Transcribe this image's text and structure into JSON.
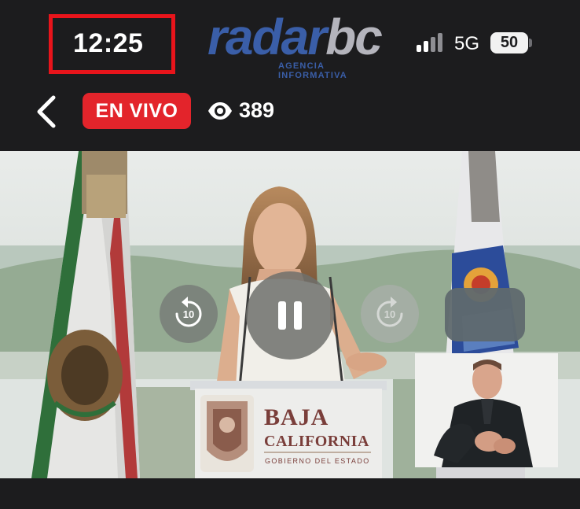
{
  "status_bar": {
    "time": "12:25",
    "network": "5G",
    "battery": "50",
    "signal_icon": "cellular-signal-icon"
  },
  "brand": {
    "name_part1": "radar",
    "name_part2": "bc",
    "tagline": "AGENCIA INFORMATIVA",
    "color_primary": "#3a5ea8",
    "color_secondary": "#b4b4bc"
  },
  "header": {
    "back_icon": "chevron-left-icon",
    "live_label": "EN VIVO",
    "live_color": "#e3242b",
    "viewers_icon": "eye-icon",
    "viewer_count": "389"
  },
  "video": {
    "podium_line1": "BAJA",
    "podium_line2": "CALIFORNIA",
    "podium_line3": "GOBIERNO DEL ESTADO",
    "controls": {
      "rewind_icon": "rewind-10-icon",
      "rewind_label": "10",
      "pause_icon": "pause-icon",
      "forward_icon": "forward-10-icon",
      "forward_label": "10"
    }
  },
  "annotation": {
    "highlight_color": "#e8141b"
  }
}
